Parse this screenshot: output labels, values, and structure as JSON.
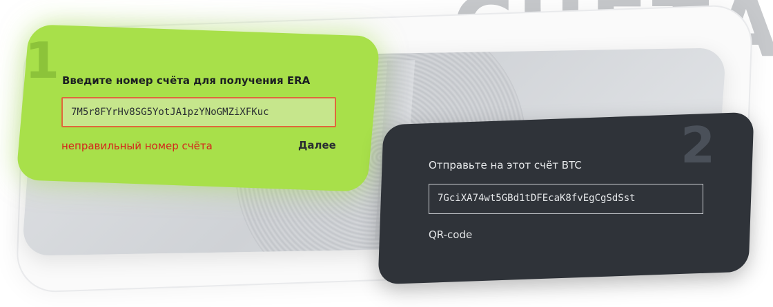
{
  "heading": {
    "text": "СЧЕТА"
  },
  "step_one": {
    "number": "1",
    "label": "Введите номер счёта для получения ERA",
    "input_value": "7M5r8FYrHv8SG5YotJA1pzYNoGMZiXFKuc",
    "error": "неправильный номер счёта",
    "next_label": "Далее"
  },
  "step_two": {
    "number": "2",
    "label": "Отправьте на этот счёт BTC",
    "address": "7GciXA74wt5GBd1tDFEcaK8fvEgCgSdSst",
    "qr_label": "QR-code"
  },
  "colors": {
    "green_card": "#a8e04a",
    "dark_card": "#2f3339",
    "error": "#d3261c",
    "input_border_error": "#e0673c"
  }
}
